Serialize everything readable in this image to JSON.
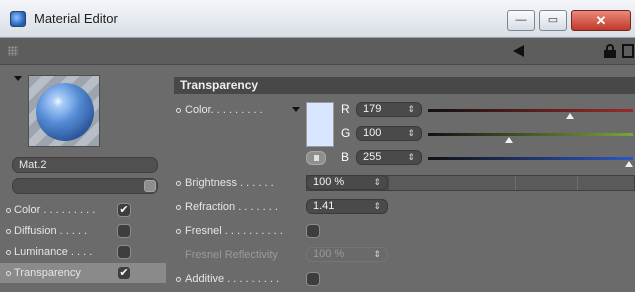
{
  "window": {
    "title": "Material Editor",
    "minimize_symbol": "—",
    "maximize_symbol": "▭",
    "close_symbol": "✕"
  },
  "toolbar": {
    "icons": [
      "grip-icon",
      "back-arrow-icon",
      "lock-icon",
      "new-window-icon"
    ]
  },
  "material": {
    "name": "Mat.2"
  },
  "channels": [
    {
      "label": "Color . . . . . . . . .",
      "checked": true,
      "check_glyph": "✔"
    },
    {
      "label": "Diffusion . . . . .",
      "checked": false,
      "check_glyph": ""
    },
    {
      "label": "Luminance . . . .",
      "checked": false,
      "check_glyph": ""
    },
    {
      "label": "Transparency",
      "checked": true,
      "active": true,
      "check_glyph": "✔"
    }
  ],
  "section": {
    "title": "Transparency"
  },
  "color_prop": {
    "label": "Color. . . . . . . . .",
    "swatch_color": "#d8e6ff",
    "channels": [
      {
        "name": "R",
        "value": "179",
        "slider_fraction": 0.7,
        "track_color": "#9a2a2a"
      },
      {
        "name": "G",
        "value": "100",
        "slider_fraction": 0.39,
        "track_color": "#7aa33a"
      },
      {
        "name": "B",
        "value": "255",
        "slider_fraction": 1.0,
        "track_color": "#2d55c4"
      }
    ]
  },
  "brightness": {
    "label": "Brightness . . . . . .",
    "value": "100 %",
    "fill_fraction": 0.25
  },
  "refraction": {
    "label": "Refraction . . . . . . .",
    "value": "1.41"
  },
  "fresnel": {
    "label": "Fresnel . . . . . . . . . .",
    "checked": false
  },
  "fresnel_reflectivity": {
    "label": "Fresnel Reflectivity",
    "value": "100 %",
    "disabled": true
  },
  "additive": {
    "label": "Additive . . . . . . . . .",
    "checked": false
  },
  "spin_glyph": "⇕"
}
